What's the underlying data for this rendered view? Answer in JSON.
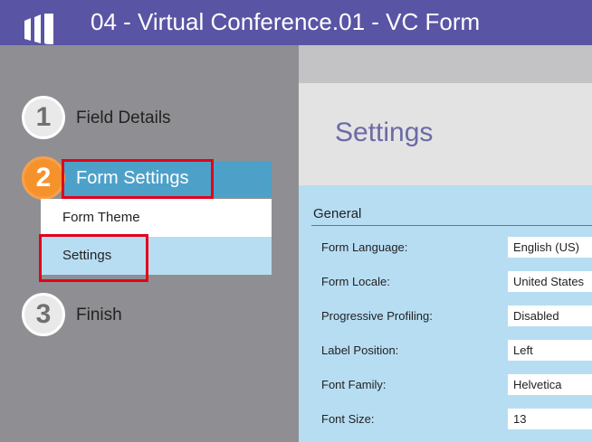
{
  "header": {
    "title": "04 - Virtual Conference.01 - VC Form",
    "logo_icon": "marketo-logo-icon",
    "colors": {
      "header": "#5a54a4"
    }
  },
  "steps": [
    {
      "number": "1",
      "label": "Field Details"
    },
    {
      "number": "2",
      "label": "Form Settings",
      "active": true
    },
    {
      "number": "3",
      "label": "Finish"
    }
  ],
  "subnav": {
    "form_theme": "Form Theme",
    "settings": "Settings"
  },
  "page": {
    "title": "Settings",
    "section": "General"
  },
  "settings": [
    {
      "label": "Form Language:",
      "value": "English (US)"
    },
    {
      "label": "Form Locale:",
      "value": "United States"
    },
    {
      "label": "Progressive Profiling:",
      "value": "Disabled"
    },
    {
      "label": "Label Position:",
      "value": "Left"
    },
    {
      "label": "Font Family:",
      "value": "Helvetica"
    },
    {
      "label": "Font Size:",
      "value": "13"
    }
  ],
  "colors": {
    "accent_orange": "#f6922c",
    "active_blue": "#4da1c9",
    "highlight_red": "#e3001b",
    "panel_blue": "#b7ddf3"
  }
}
